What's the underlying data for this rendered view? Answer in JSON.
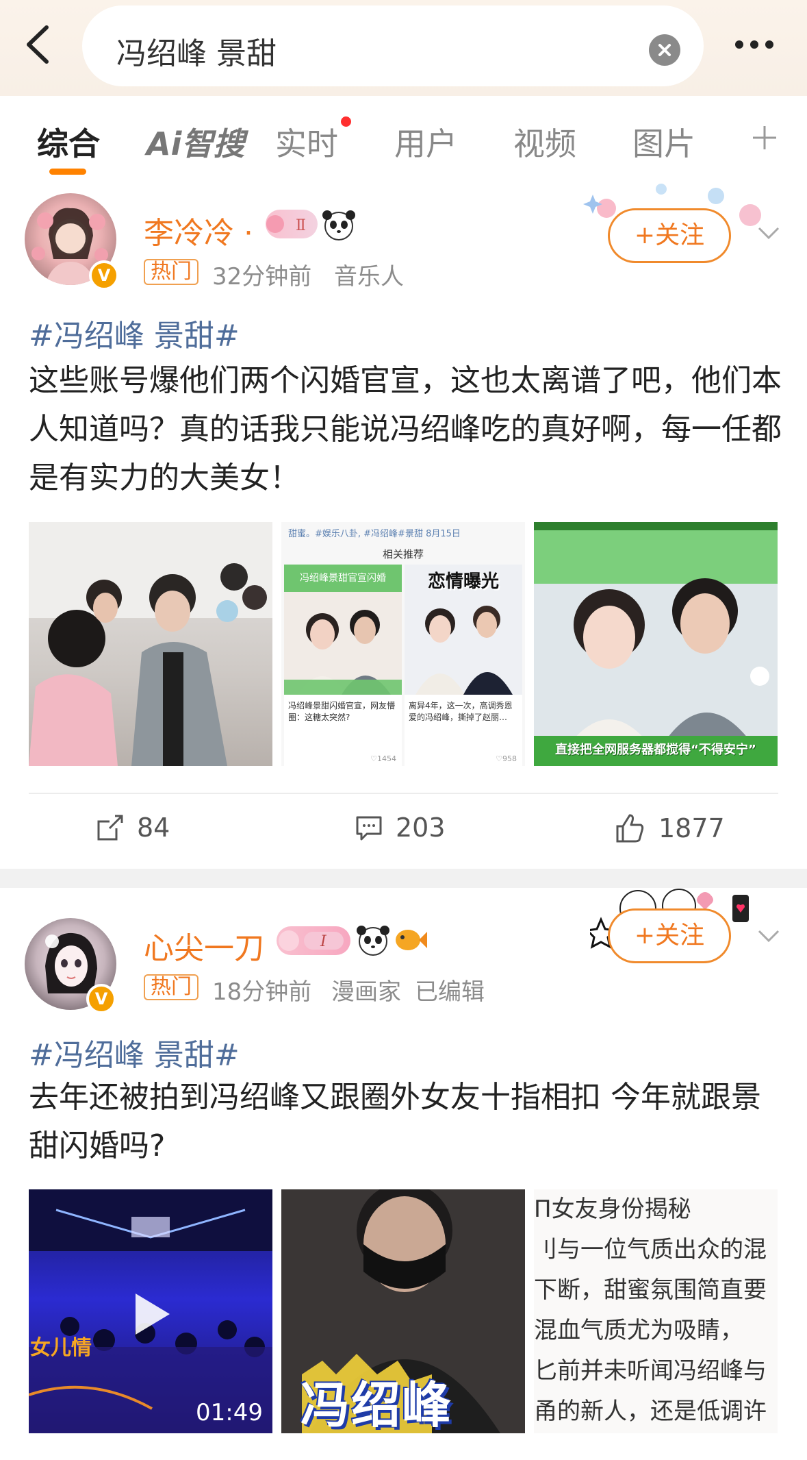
{
  "search": {
    "query": "冯绍峰 景甜"
  },
  "tabs": [
    {
      "label": "综合"
    },
    {
      "label": "Ai智搜"
    },
    {
      "label": "实时"
    },
    {
      "label": "用户"
    },
    {
      "label": "视频"
    },
    {
      "label": "图片"
    }
  ],
  "posts": [
    {
      "username": "李冷冷 ·",
      "hot_label": "热门",
      "time": "32分钟前",
      "role": "音乐人",
      "follow_label": "+关注",
      "hashtag": "#冯绍峰 景甜#",
      "text": "这些账号爆他们两个闪婚官宣，这也太离谱了吧，他们本人知道吗？真的话我只能说冯绍峰吃的真好啊，每一任都是有实力的大美女！",
      "image2_header": "甜蜜。#娱乐八卦, #冯绍峰#景甜  8月15日",
      "image2_sub": "相关推荐",
      "image2_card1_title": "冯绍峰景甜官宣闪婚",
      "image2_card2_title": "恋情曝光",
      "image2_card1_text": "冯绍峰景甜闪婚官宣，网友懵圈：这糖太突然?",
      "image2_card2_text": "离异4年，这一次，高调秀恩爱的冯绍峰，撕掉了赵丽…",
      "image2_card1_likes": "♡1454",
      "image2_card2_likes": "♡958",
      "image3_caption": "直接把全网服务器都搅得“不得安宁”",
      "reposts": "84",
      "comments": "203",
      "likes": "1877"
    },
    {
      "username": "心尖一刀",
      "hot_label": "热门",
      "time": "18分钟前",
      "role": "漫画家",
      "edited": "已编辑",
      "follow_label": "+关注",
      "hashtag": "#冯绍峰 景甜#",
      "text": "去年还被拍到冯绍峰又跟圈外女友十指相扣 今年就跟景甜闪婚吗?",
      "video_title": "女儿情",
      "video_duration": "01:49",
      "image2_caption": "冯绍峰",
      "text_image_lines": [
        "П女友身份揭秘",
        "刂与一位气质出众的混",
        "下断，甜蜜氛围简直要",
        "混血气质尤为吸睛，",
        "匕前并未听闻冯绍峰与",
        "甬的新人，还是低调许"
      ]
    }
  ],
  "colors": {
    "accent": "#ff8200",
    "username": "#f07820",
    "hashtag": "#4f6d9a"
  }
}
